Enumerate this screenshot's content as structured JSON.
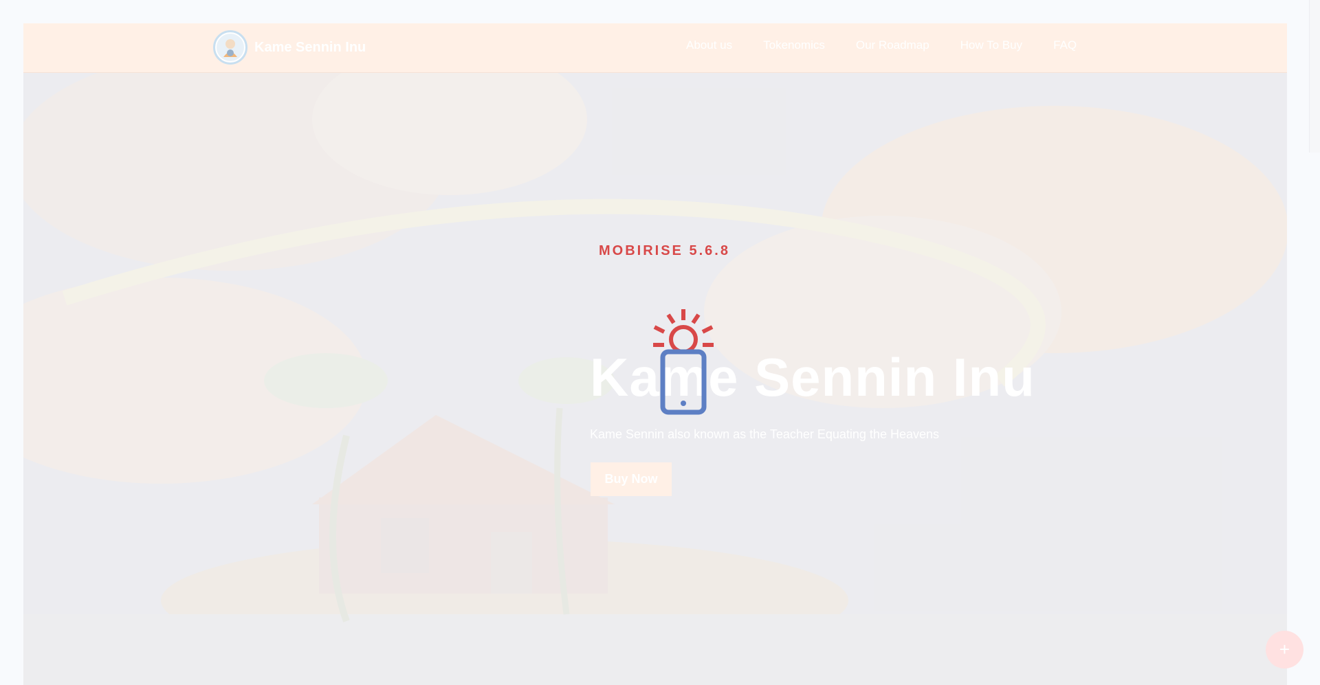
{
  "brand": {
    "name": "Kame Sennin Inu",
    "logo_icon": "turtle-hermit-avatar-icon"
  },
  "nav": {
    "items": [
      {
        "label": "About us"
      },
      {
        "label": "Tokenomics"
      },
      {
        "label": "Our Roadmap"
      },
      {
        "label": "How To Buy"
      },
      {
        "label": "FAQ"
      }
    ]
  },
  "hero": {
    "tag": "MOBIRISE 5.6.8",
    "title": "Kame Sennin Inu",
    "subtitle": "Kame Sennin also known as the Teacher Equating the Heavens",
    "button_label": "Buy Now",
    "overlay_icon": "mobile-phone-sun-icon"
  },
  "fab": {
    "icon": "plus-icon",
    "label": "+"
  },
  "colors": {
    "navbar_bg": "#fff0e6",
    "accent_red": "#d84848",
    "phone_blue": "#5d7fc4",
    "button_bg": "#fff0e6"
  }
}
